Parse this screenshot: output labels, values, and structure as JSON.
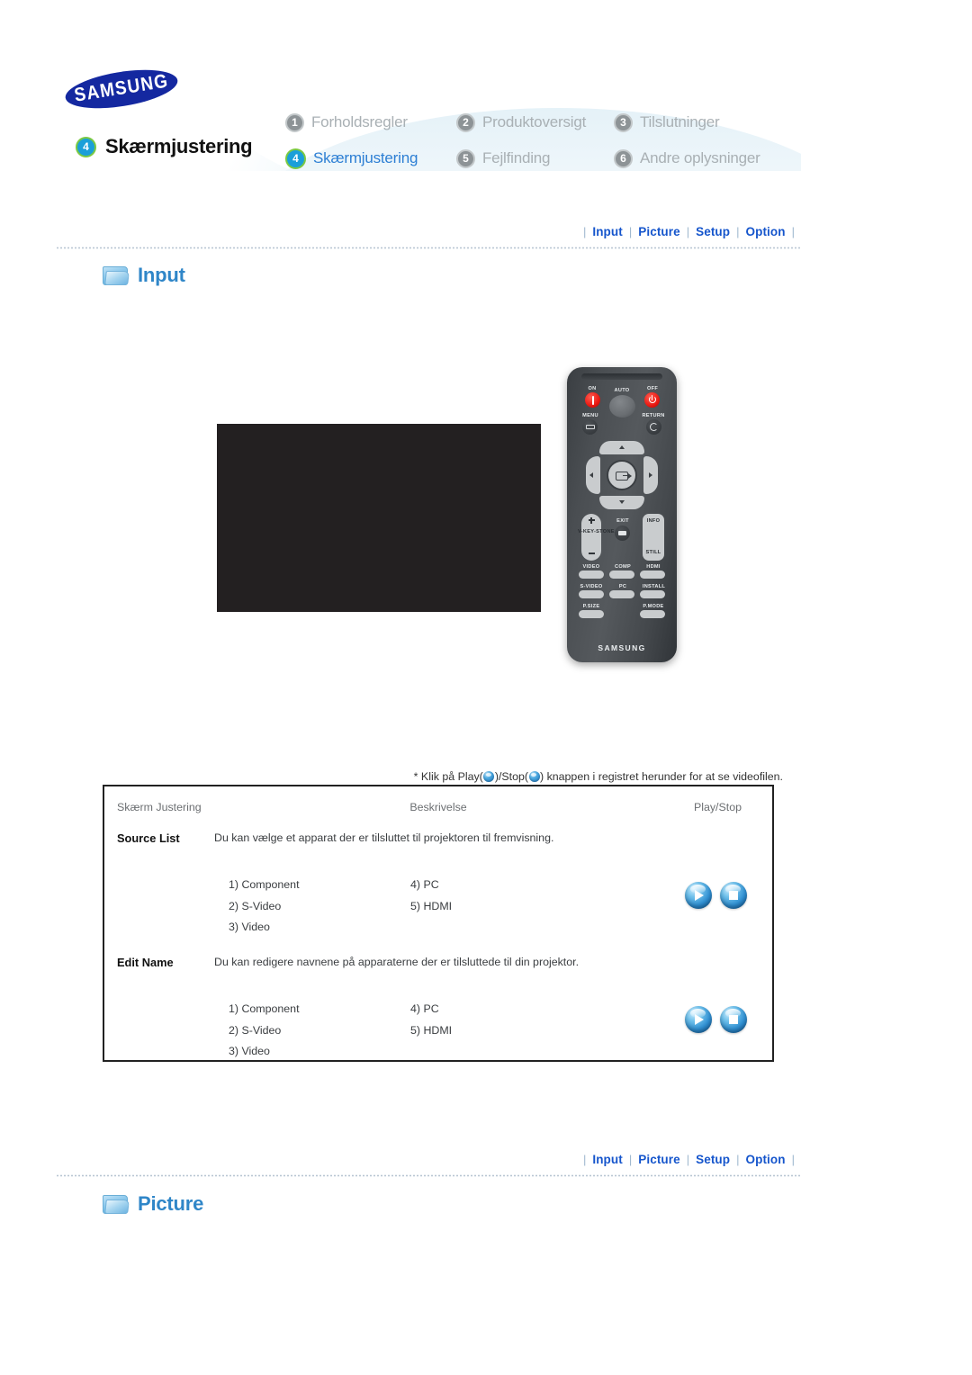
{
  "header": {
    "logo_text": "SAMSUNG",
    "current_section": {
      "number": "4",
      "label": "Skærmjustering"
    },
    "menu": [
      {
        "number": "1",
        "label": "Forholdsregler",
        "current": false
      },
      {
        "number": "2",
        "label": "Produktoversigt",
        "current": false
      },
      {
        "number": "3",
        "label": "Tilslutninger",
        "current": false
      },
      {
        "number": "4",
        "label": "Skærmjustering",
        "current": true
      },
      {
        "number": "5",
        "label": "Fejlfinding",
        "current": false
      },
      {
        "number": "6",
        "label": "Andre oplysninger",
        "current": false
      }
    ]
  },
  "nav": {
    "separator": "|",
    "items": [
      {
        "label": "Input"
      },
      {
        "label": "Picture"
      },
      {
        "label": "Setup"
      },
      {
        "label": "Option"
      }
    ]
  },
  "sections": {
    "input_title": "Input",
    "picture_title": "Picture"
  },
  "remote": {
    "brand": "SAMSUNG",
    "labels": {
      "on": "ON",
      "auto": "AUTO",
      "off": "OFF",
      "menu": "MENU",
      "return": "RETURN",
      "keystone": "V-KEY-STONE",
      "exit": "EXIT",
      "info": "INFO",
      "still": "STILL",
      "video": "VIDEO",
      "comp": "COMP",
      "hdmi": "HDMI",
      "svideo": "S-VIDEO",
      "pc": "PC",
      "install": "INSTALL",
      "psize": "P.SIZE",
      "pmode": "P.MODE"
    }
  },
  "note": {
    "prefix": "* Klik på Play(",
    "middle": ")/Stop(",
    "suffix": ") knappen i registret herunder for at se videofilen."
  },
  "table": {
    "headers": [
      "Skærm Justering",
      "Beskrivelse",
      "Play/Stop"
    ],
    "rows": [
      {
        "name": "Source List",
        "description": "Du kan vælge et apparat der er tilsluttet til projektoren til fremvisning.",
        "options_left": [
          "1) Component",
          "2) S-Video",
          "3) Video"
        ],
        "options_right": [
          "4) PC",
          "5) HDMI"
        ],
        "play_label": "Play",
        "stop_label": "Stop"
      },
      {
        "name": "Edit Name",
        "description": "Du kan redigere navnene på apparaterne der er tilsluttede til din projektor.",
        "options_left": [
          "1) Component",
          "2) S-Video",
          "3) Video"
        ],
        "options_right": [
          "4) PC",
          "5) HDMI"
        ],
        "play_label": "Play",
        "stop_label": "Stop"
      }
    ]
  },
  "colors": {
    "nav_link": "#1555cc",
    "section_title": "#2f86c8",
    "badge_active_fill": "#1a9fd9",
    "badge_active_ring": "#7ac943",
    "badge_inactive": "#8d9396",
    "video_box": "#232021"
  }
}
